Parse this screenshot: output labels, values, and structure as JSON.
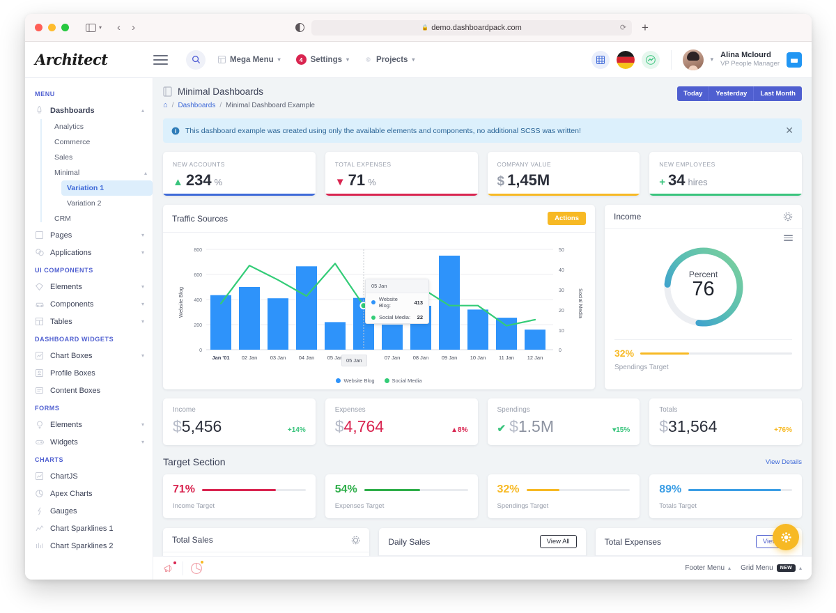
{
  "browser": {
    "url": "demo.dashboardpack.com",
    "lock_icon": "lock-icon",
    "reload_icon": "reload-icon",
    "new_tab_icon": "plus-icon",
    "back_icon": "chevron-left-icon",
    "forward_icon": "chevron-right-icon",
    "sidebar_icon": "sidebar-toggle-icon",
    "shield_icon": "privacy-shield-icon"
  },
  "topnav": {
    "logo": "Architect",
    "menu_icon": "hamburger-icon",
    "search_icon": "search-icon",
    "items": [
      {
        "label": "Mega Menu",
        "icon": "grid-icon",
        "badge": ""
      },
      {
        "label": "Settings",
        "icon": "badge-count",
        "badge": "4"
      },
      {
        "label": "Projects",
        "icon": "gear-icon",
        "badge": ""
      }
    ],
    "right_icons": [
      "grid-blue-icon",
      "flag-germany-icon",
      "chart-green-icon"
    ],
    "user": {
      "name": "Alina Mclourd",
      "role": "VP People Manager"
    },
    "panel_icon": "window-panel-icon"
  },
  "sidebar": {
    "sections": [
      {
        "heading": "MENU",
        "items": [
          {
            "label": "Dashboards",
            "icon": "rocket-icon",
            "chevron": "up",
            "bold": true,
            "children": [
              {
                "label": "Analytics"
              },
              {
                "label": "Commerce"
              },
              {
                "label": "Sales"
              },
              {
                "label": "Minimal",
                "chevron": "up",
                "children": [
                  {
                    "label": "Variation 1",
                    "active": true
                  },
                  {
                    "label": "Variation 2",
                    "active": false
                  }
                ]
              },
              {
                "label": "CRM"
              }
            ]
          },
          {
            "label": "Pages",
            "icon": "page-icon",
            "chevron": "down"
          },
          {
            "label": "Applications",
            "icon": "apps-icon",
            "chevron": "down"
          }
        ]
      },
      {
        "heading": "UI COMPONENTS",
        "items": [
          {
            "label": "Elements",
            "icon": "diamond-icon",
            "chevron": "down"
          },
          {
            "label": "Components",
            "icon": "car-icon",
            "chevron": "down"
          },
          {
            "label": "Tables",
            "icon": "table-icon",
            "chevron": "down"
          }
        ]
      },
      {
        "heading": "DASHBOARD WIDGETS",
        "items": [
          {
            "label": "Chart Boxes",
            "icon": "chart-box-icon",
            "chevron": "down"
          },
          {
            "label": "Profile Boxes",
            "icon": "profile-box-icon",
            "chevron": ""
          },
          {
            "label": "Content Boxes",
            "icon": "content-box-icon",
            "chevron": ""
          }
        ]
      },
      {
        "heading": "FORMS",
        "items": [
          {
            "label": "Elements",
            "icon": "bulb-icon",
            "chevron": "down"
          },
          {
            "label": "Widgets",
            "icon": "gamepad-icon",
            "chevron": "down"
          }
        ]
      },
      {
        "heading": "CHARTS",
        "items": [
          {
            "label": "ChartJS",
            "icon": "chart-line-icon",
            "chevron": ""
          },
          {
            "label": "Apex Charts",
            "icon": "pie-chart-icon",
            "chevron": ""
          },
          {
            "label": "Gauges",
            "icon": "gauge-icon",
            "chevron": ""
          },
          {
            "label": "Chart Sparklines 1",
            "icon": "sparkline-icon",
            "chevron": ""
          },
          {
            "label": "Chart Sparklines 2",
            "icon": "bars-icon",
            "chevron": ""
          }
        ]
      }
    ]
  },
  "page": {
    "title": "Minimal Dashboards",
    "title_icon": "document-icon",
    "breadcrumb": {
      "home_icon": "home-icon",
      "links": [
        "Dashboards"
      ],
      "current": "Minimal Dashboard Example"
    },
    "range_buttons": [
      "Today",
      "Yesterday",
      "Last Month"
    ],
    "alert": {
      "icon": "info-circle-icon",
      "text": "This dashboard example was created using only the available elements and components, no additional SCSS was written!",
      "close_icon": "close-icon"
    }
  },
  "stat_cards": [
    {
      "label": "NEW ACCOUNTS",
      "arrow": "▲",
      "arrow_color": "#3ac47d",
      "symbol": "",
      "value": "234",
      "unit": "%",
      "bar_color": "#3f6ad8"
    },
    {
      "label": "TOTAL EXPENSES",
      "arrow": "▼",
      "arrow_color": "#d92550",
      "symbol": "",
      "value": "71",
      "unit": "%",
      "bar_color": "#d92550"
    },
    {
      "label": "COMPANY VALUE",
      "arrow": "",
      "arrow_color": "",
      "symbol": "$",
      "value": "1,45M",
      "unit": "",
      "bar_color": "#f7b924"
    },
    {
      "label": "NEW EMPLOYEES",
      "arrow": "+",
      "arrow_color": "#3ac47d",
      "symbol": "",
      "value": "34",
      "unit": "hires",
      "bar_color": "#3ac47d"
    }
  ],
  "traffic_panel": {
    "title": "Traffic Sources",
    "actions_label": "Actions"
  },
  "chart_data": {
    "type": "bar",
    "title": "Traffic Sources",
    "categories": [
      "Jan '01",
      "02 Jan",
      "03 Jan",
      "04 Jan",
      "05 Jan",
      "05 Jan",
      "07 Jan",
      "08 Jan",
      "09 Jan",
      "10 Jan",
      "11 Jan",
      "12 Jan"
    ],
    "series": [
      {
        "name": "Website Blog",
        "type": "bar",
        "color": "#2e93fa",
        "axis": "left",
        "values": [
          435,
          500,
          410,
          665,
          220,
          413,
          200,
          350,
          750,
          320,
          255,
          160
        ]
      },
      {
        "name": "Social Media",
        "type": "line",
        "color": "#33cc77",
        "axis": "right",
        "values": [
          23,
          42,
          35,
          27,
          43,
          22,
          17,
          31,
          22,
          22,
          12,
          15
        ]
      }
    ],
    "ylabel": "Website Blog",
    "y2label": "Social Media",
    "ylim": [
      0,
      800
    ],
    "yticks": [
      0,
      200,
      400,
      600,
      800
    ],
    "y2lim": [
      0,
      50
    ],
    "y2ticks": [
      0,
      10,
      20,
      30,
      40,
      50
    ],
    "grid": true,
    "legend": [
      "Website Blog",
      "Social Media"
    ],
    "legend_position": "bottom",
    "tooltip": {
      "title": "05 Jan",
      "rows": [
        {
          "name": "Website Blog:",
          "value": "413",
          "color": "#2e93fa"
        },
        {
          "name": "Social Media:",
          "value": "22",
          "color": "#33cc77"
        }
      ]
    },
    "hovered_xlabel": "05 Jan"
  },
  "income_panel": {
    "title": "Income",
    "gear_icon": "gear-icon",
    "menu_icon": "hamburger-menu-icon",
    "donut": {
      "label": "Percent",
      "value": "76",
      "percent": 76,
      "color_start": "#7ed19a",
      "color_end": "#2b8ee0"
    },
    "spendings": {
      "pct_label": "32%",
      "percent": 32,
      "caption": "Spendings Target",
      "color": "#f7b924"
    }
  },
  "mid_cards": [
    {
      "label": "Income",
      "check": "",
      "check_color": "",
      "currency": "$",
      "amount": "5,456",
      "amount_color": "#2b2f3a",
      "delta": "+14%",
      "delta_color": "#3ac47d"
    },
    {
      "label": "Expenses",
      "check": "",
      "check_color": "",
      "currency": "$",
      "amount": "4,764",
      "amount_color": "#d92550",
      "delta": "▲8%",
      "delta_color": "#d92550"
    },
    {
      "label": "Spendings",
      "check": "✔",
      "check_color": "#3ac47d",
      "currency": "$",
      "amount": "1.5M",
      "amount_color": "#8d93a1",
      "delta": "▾15%",
      "delta_color": "#3ac47d"
    },
    {
      "label": "Totals",
      "check": "",
      "check_color": "",
      "currency": "$",
      "amount": "31,564",
      "amount_color": "#2b2f3a",
      "delta": "+76%",
      "delta_color": "#f7b924"
    }
  ],
  "target_section": {
    "title": "Target Section",
    "view_details": "View Details",
    "cards": [
      {
        "pct_label": "71%",
        "percent": 71,
        "caption": "Income Target",
        "color": "#d92550"
      },
      {
        "pct_label": "54%",
        "percent": 54,
        "caption": "Expenses Target",
        "color": "#2fae4a"
      },
      {
        "pct_label": "32%",
        "percent": 32,
        "caption": "Spendings Target",
        "color": "#f7b924"
      },
      {
        "pct_label": "89%",
        "percent": 89,
        "caption": "Totals Target",
        "color": "#3c9ee5"
      }
    ]
  },
  "bottom_panels": [
    {
      "title": "Total Sales",
      "action": "",
      "icon": "gear-icon"
    },
    {
      "title": "Daily Sales",
      "action": "View All",
      "icon": ""
    },
    {
      "title": "Total Expenses",
      "action": "View All",
      "icon": ""
    }
  ],
  "footer": {
    "left_icons": [
      "megaphone-icon",
      "pie-chart-icon"
    ],
    "items": [
      {
        "label": "Footer Menu",
        "chevron": "up",
        "badge": ""
      },
      {
        "label": "Grid Menu",
        "chevron": "up",
        "badge": "NEW"
      }
    ]
  },
  "fab": {
    "icon": "gear-icon",
    "color": "#f7b924"
  }
}
